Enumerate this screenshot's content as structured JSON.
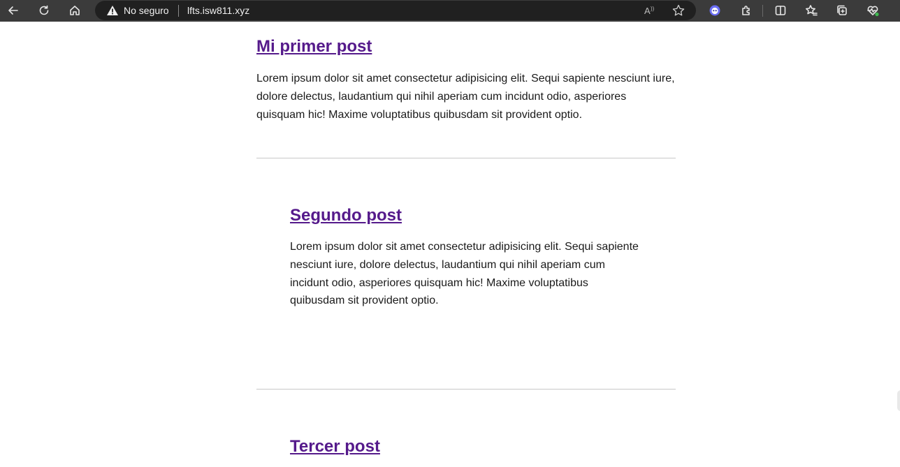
{
  "browser": {
    "security_label": "No seguro",
    "url": "lfts.isw811.xyz",
    "icons": [
      "back-arrow-icon",
      "refresh-icon",
      "home-icon",
      "warning-icon",
      "read-aloud-icon",
      "favorite-star-icon",
      "copilot-icon",
      "extensions-icon",
      "split-screen-icon",
      "favorites-icon",
      "collections-icon",
      "performance-icon"
    ]
  },
  "posts": [
    {
      "title": "Mi primer post",
      "body": "Lorem ipsum dolor sit amet consectetur adipisicing elit. Sequi sapiente nesciunt iure, dolore delectus, laudantium qui nihil aperiam cum incidunt odio, asperiores quisquam hic! Maxime voluptatibus quibusdam sit provident optio."
    },
    {
      "title": "Segundo post",
      "body": "Lorem ipsum dolor sit amet consectetur adipisicing elit. Sequi sapiente nesciunt iure, dolore delectus, laudantium qui nihil aperiam cum incidunt odio, asperiores quisquam hic! Maxime voluptatibus quibusdam sit provident optio."
    },
    {
      "title": "Tercer post"
    }
  ],
  "colors": {
    "link_visited": "#551a8b",
    "toolbar": "#3b3b3b",
    "addressbar": "#202020"
  }
}
